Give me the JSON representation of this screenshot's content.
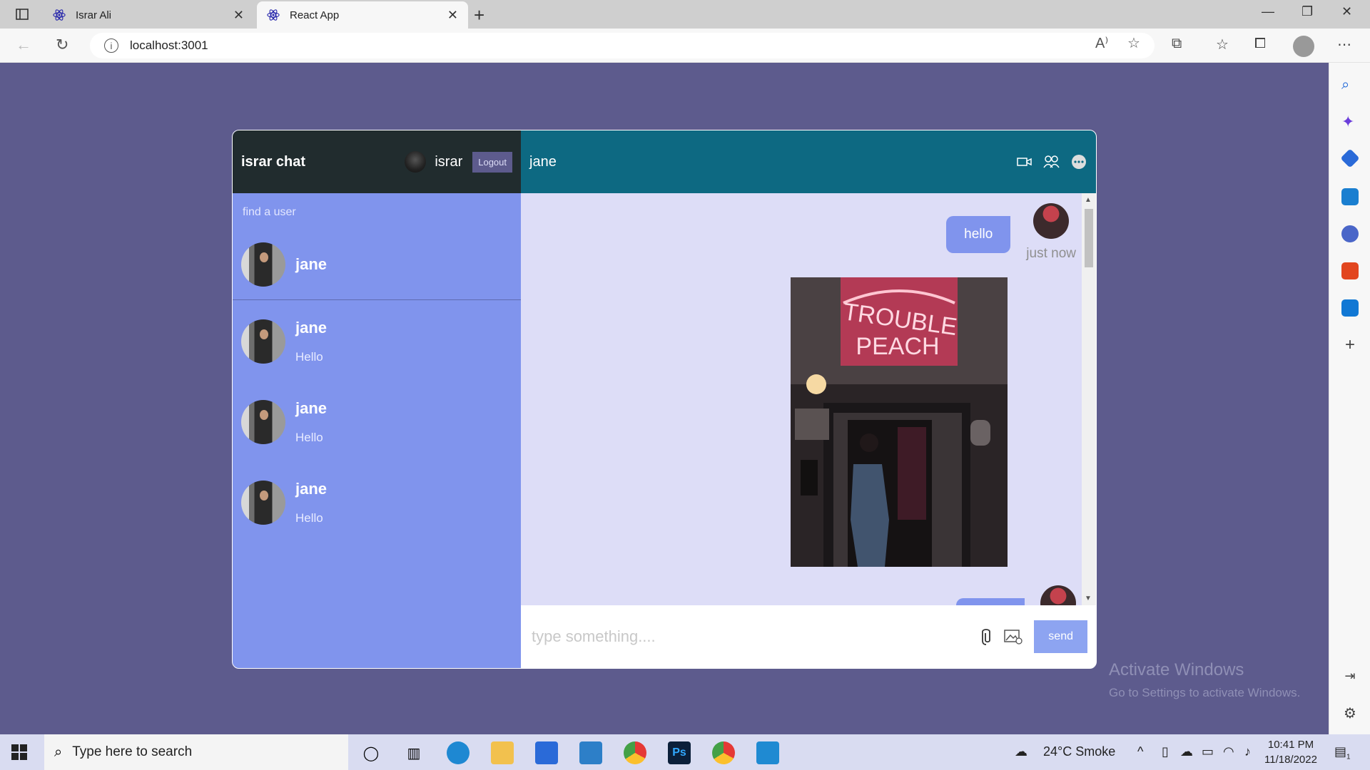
{
  "browser": {
    "tabs": [
      {
        "title": "Israr Ali",
        "active": false
      },
      {
        "title": "React App",
        "active": true
      }
    ],
    "url": "localhost:3001"
  },
  "app": {
    "logo": "israr chat",
    "current_user": "israr",
    "logout_label": "Logout",
    "search_placeholder": "find a user",
    "search_result": {
      "name": "jane"
    },
    "chats": [
      {
        "name": "jane",
        "last_message": "Hello"
      },
      {
        "name": "jane",
        "last_message": "Hello"
      },
      {
        "name": "jane",
        "last_message": "Hello"
      }
    ],
    "chat_header": {
      "name": "jane"
    },
    "messages": [
      {
        "text": "hello",
        "time": "just now",
        "owner": true
      },
      {
        "type": "image",
        "caption_in_image": "TROUBLE PEACH"
      }
    ],
    "input_placeholder": "type something....",
    "send_label": "send"
  },
  "watermark": {
    "line1": "Activate Windows",
    "line2": "Go to Settings to activate Windows."
  },
  "taskbar": {
    "search_placeholder": "Type here to search",
    "weather": "24°C  Smoke",
    "time": "10:41 PM",
    "date": "11/18/2022",
    "notification_count": "1"
  },
  "colors": {
    "page_bg": "#5d5b8d",
    "sidebar_bg": "#8094ed",
    "sidebar_header": "#212c2e",
    "chat_header": "#0d6982",
    "messages_bg": "#ddddf7"
  }
}
